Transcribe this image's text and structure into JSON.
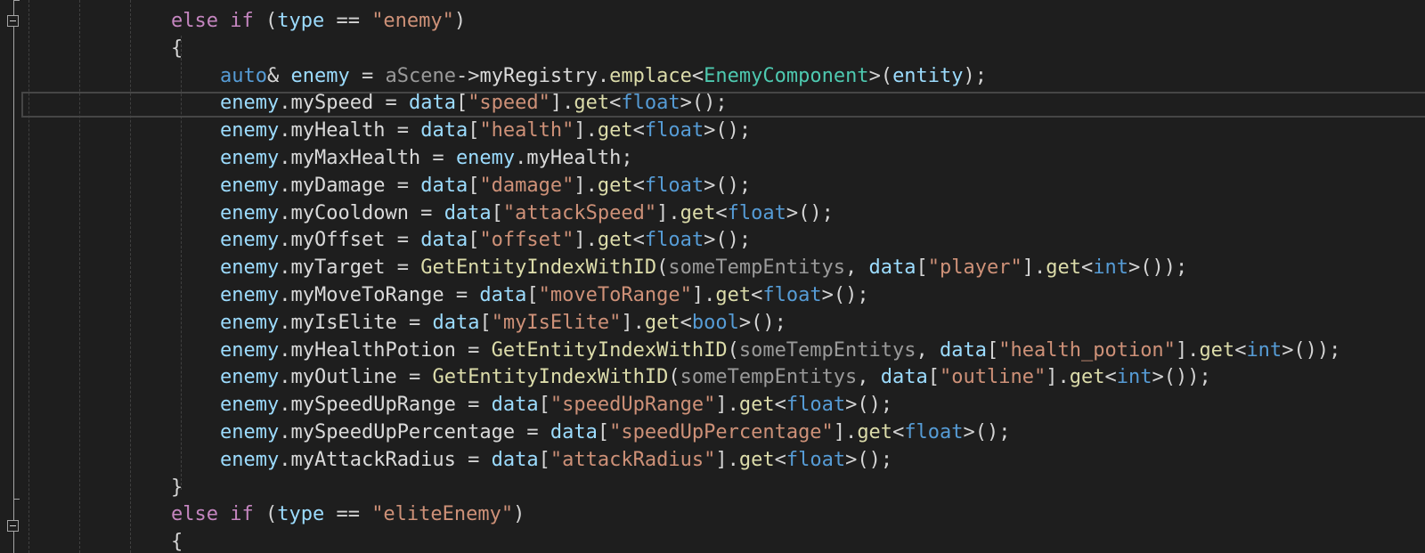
{
  "editor": {
    "lines": [
      [
        {
          "t": "else if",
          "c": "kw"
        },
        {
          "t": " (",
          "c": "punc"
        },
        {
          "t": "type",
          "c": "var"
        },
        {
          "t": " == ",
          "c": "punc"
        },
        {
          "t": "\"enemy\"",
          "c": "str"
        },
        {
          "t": ")",
          "c": "punc"
        }
      ],
      [
        {
          "t": "{",
          "c": "punc"
        }
      ],
      [
        {
          "t": "auto",
          "c": "kwb"
        },
        {
          "t": "& ",
          "c": "punc"
        },
        {
          "t": "enemy",
          "c": "var"
        },
        {
          "t": " = ",
          "c": "punc"
        },
        {
          "t": "aScene",
          "c": "gray"
        },
        {
          "t": "->",
          "c": "punc"
        },
        {
          "t": "myRegistry",
          "c": "mem"
        },
        {
          "t": ".",
          "c": "punc"
        },
        {
          "t": "emplace",
          "c": "fn"
        },
        {
          "t": "<",
          "c": "punc"
        },
        {
          "t": "EnemyComponent",
          "c": "ty"
        },
        {
          "t": ">(",
          "c": "punc"
        },
        {
          "t": "entity",
          "c": "var"
        },
        {
          "t": ");",
          "c": "punc"
        }
      ],
      [
        {
          "t": "enemy",
          "c": "var"
        },
        {
          "t": ".",
          "c": "punc"
        },
        {
          "t": "mySpeed",
          "c": "mem"
        },
        {
          "t": " = ",
          "c": "punc"
        },
        {
          "t": "data",
          "c": "var"
        },
        {
          "t": "[",
          "c": "punc"
        },
        {
          "t": "\"speed\"",
          "c": "str"
        },
        {
          "t": "].",
          "c": "punc"
        },
        {
          "t": "get",
          "c": "fn"
        },
        {
          "t": "<",
          "c": "punc"
        },
        {
          "t": "float",
          "c": "kwb"
        },
        {
          "t": ">();",
          "c": "punc"
        }
      ],
      [
        {
          "t": "enemy",
          "c": "var"
        },
        {
          "t": ".",
          "c": "punc"
        },
        {
          "t": "myHealth",
          "c": "mem"
        },
        {
          "t": " = ",
          "c": "punc"
        },
        {
          "t": "data",
          "c": "var"
        },
        {
          "t": "[",
          "c": "punc"
        },
        {
          "t": "\"health\"",
          "c": "str"
        },
        {
          "t": "].",
          "c": "punc"
        },
        {
          "t": "get",
          "c": "fn"
        },
        {
          "t": "<",
          "c": "punc"
        },
        {
          "t": "float",
          "c": "kwb"
        },
        {
          "t": ">();",
          "c": "punc"
        }
      ],
      [
        {
          "t": "enemy",
          "c": "var"
        },
        {
          "t": ".",
          "c": "punc"
        },
        {
          "t": "myMaxHealth",
          "c": "mem"
        },
        {
          "t": " = ",
          "c": "punc"
        },
        {
          "t": "enemy",
          "c": "var"
        },
        {
          "t": ".",
          "c": "punc"
        },
        {
          "t": "myHealth",
          "c": "mem"
        },
        {
          "t": ";",
          "c": "punc"
        }
      ],
      [
        {
          "t": "enemy",
          "c": "var"
        },
        {
          "t": ".",
          "c": "punc"
        },
        {
          "t": "myDamage",
          "c": "mem"
        },
        {
          "t": " = ",
          "c": "punc"
        },
        {
          "t": "data",
          "c": "var"
        },
        {
          "t": "[",
          "c": "punc"
        },
        {
          "t": "\"damage\"",
          "c": "str"
        },
        {
          "t": "].",
          "c": "punc"
        },
        {
          "t": "get",
          "c": "fn"
        },
        {
          "t": "<",
          "c": "punc"
        },
        {
          "t": "float",
          "c": "kwb"
        },
        {
          "t": ">();",
          "c": "punc"
        }
      ],
      [
        {
          "t": "enemy",
          "c": "var"
        },
        {
          "t": ".",
          "c": "punc"
        },
        {
          "t": "myCooldown",
          "c": "mem"
        },
        {
          "t": " = ",
          "c": "punc"
        },
        {
          "t": "data",
          "c": "var"
        },
        {
          "t": "[",
          "c": "punc"
        },
        {
          "t": "\"attackSpeed\"",
          "c": "str"
        },
        {
          "t": "].",
          "c": "punc"
        },
        {
          "t": "get",
          "c": "fn"
        },
        {
          "t": "<",
          "c": "punc"
        },
        {
          "t": "float",
          "c": "kwb"
        },
        {
          "t": ">();",
          "c": "punc"
        }
      ],
      [
        {
          "t": "enemy",
          "c": "var"
        },
        {
          "t": ".",
          "c": "punc"
        },
        {
          "t": "myOffset",
          "c": "mem"
        },
        {
          "t": " = ",
          "c": "punc"
        },
        {
          "t": "data",
          "c": "var"
        },
        {
          "t": "[",
          "c": "punc"
        },
        {
          "t": "\"offset\"",
          "c": "str"
        },
        {
          "t": "].",
          "c": "punc"
        },
        {
          "t": "get",
          "c": "fn"
        },
        {
          "t": "<",
          "c": "punc"
        },
        {
          "t": "float",
          "c": "kwb"
        },
        {
          "t": ">();",
          "c": "punc"
        }
      ],
      [
        {
          "t": "enemy",
          "c": "var"
        },
        {
          "t": ".",
          "c": "punc"
        },
        {
          "t": "myTarget",
          "c": "mem"
        },
        {
          "t": " = ",
          "c": "punc"
        },
        {
          "t": "GetEntityIndexWithID",
          "c": "fn"
        },
        {
          "t": "(",
          "c": "punc"
        },
        {
          "t": "someTempEntitys",
          "c": "gray"
        },
        {
          "t": ", ",
          "c": "punc"
        },
        {
          "t": "data",
          "c": "var"
        },
        {
          "t": "[",
          "c": "punc"
        },
        {
          "t": "\"player\"",
          "c": "str"
        },
        {
          "t": "].",
          "c": "punc"
        },
        {
          "t": "get",
          "c": "fn"
        },
        {
          "t": "<",
          "c": "punc"
        },
        {
          "t": "int",
          "c": "kwb"
        },
        {
          "t": ">());",
          "c": "punc"
        }
      ],
      [
        {
          "t": "enemy",
          "c": "var"
        },
        {
          "t": ".",
          "c": "punc"
        },
        {
          "t": "myMoveToRange",
          "c": "mem"
        },
        {
          "t": " = ",
          "c": "punc"
        },
        {
          "t": "data",
          "c": "var"
        },
        {
          "t": "[",
          "c": "punc"
        },
        {
          "t": "\"moveToRange\"",
          "c": "str"
        },
        {
          "t": "].",
          "c": "punc"
        },
        {
          "t": "get",
          "c": "fn"
        },
        {
          "t": "<",
          "c": "punc"
        },
        {
          "t": "float",
          "c": "kwb"
        },
        {
          "t": ">();",
          "c": "punc"
        }
      ],
      [
        {
          "t": "enemy",
          "c": "var"
        },
        {
          "t": ".",
          "c": "punc"
        },
        {
          "t": "myIsElite",
          "c": "mem"
        },
        {
          "t": " = ",
          "c": "punc"
        },
        {
          "t": "data",
          "c": "var"
        },
        {
          "t": "[",
          "c": "punc"
        },
        {
          "t": "\"myIsElite\"",
          "c": "str"
        },
        {
          "t": "].",
          "c": "punc"
        },
        {
          "t": "get",
          "c": "fn"
        },
        {
          "t": "<",
          "c": "punc"
        },
        {
          "t": "bool",
          "c": "kwb"
        },
        {
          "t": ">();",
          "c": "punc"
        }
      ],
      [
        {
          "t": "enemy",
          "c": "var"
        },
        {
          "t": ".",
          "c": "punc"
        },
        {
          "t": "myHealthPotion",
          "c": "mem"
        },
        {
          "t": " = ",
          "c": "punc"
        },
        {
          "t": "GetEntityIndexWithID",
          "c": "fn"
        },
        {
          "t": "(",
          "c": "punc"
        },
        {
          "t": "someTempEntitys",
          "c": "gray"
        },
        {
          "t": ", ",
          "c": "punc"
        },
        {
          "t": "data",
          "c": "var"
        },
        {
          "t": "[",
          "c": "punc"
        },
        {
          "t": "\"health_potion\"",
          "c": "str"
        },
        {
          "t": "].",
          "c": "punc"
        },
        {
          "t": "get",
          "c": "fn"
        },
        {
          "t": "<",
          "c": "punc"
        },
        {
          "t": "int",
          "c": "kwb"
        },
        {
          "t": ">());",
          "c": "punc"
        }
      ],
      [
        {
          "t": "enemy",
          "c": "var"
        },
        {
          "t": ".",
          "c": "punc"
        },
        {
          "t": "myOutline",
          "c": "mem"
        },
        {
          "t": " = ",
          "c": "punc"
        },
        {
          "t": "GetEntityIndexWithID",
          "c": "fn"
        },
        {
          "t": "(",
          "c": "punc"
        },
        {
          "t": "someTempEntitys",
          "c": "gray"
        },
        {
          "t": ", ",
          "c": "punc"
        },
        {
          "t": "data",
          "c": "var"
        },
        {
          "t": "[",
          "c": "punc"
        },
        {
          "t": "\"outline\"",
          "c": "str"
        },
        {
          "t": "].",
          "c": "punc"
        },
        {
          "t": "get",
          "c": "fn"
        },
        {
          "t": "<",
          "c": "punc"
        },
        {
          "t": "int",
          "c": "kwb"
        },
        {
          "t": ">());",
          "c": "punc"
        }
      ],
      [
        {
          "t": "enemy",
          "c": "var"
        },
        {
          "t": ".",
          "c": "punc"
        },
        {
          "t": "mySpeedUpRange",
          "c": "mem"
        },
        {
          "t": " = ",
          "c": "punc"
        },
        {
          "t": "data",
          "c": "var"
        },
        {
          "t": "[",
          "c": "punc"
        },
        {
          "t": "\"speedUpRange\"",
          "c": "str"
        },
        {
          "t": "].",
          "c": "punc"
        },
        {
          "t": "get",
          "c": "fn"
        },
        {
          "t": "<",
          "c": "punc"
        },
        {
          "t": "float",
          "c": "kwb"
        },
        {
          "t": ">();",
          "c": "punc"
        }
      ],
      [
        {
          "t": "enemy",
          "c": "var"
        },
        {
          "t": ".",
          "c": "punc"
        },
        {
          "t": "mySpeedUpPercentage",
          "c": "mem"
        },
        {
          "t": " = ",
          "c": "punc"
        },
        {
          "t": "data",
          "c": "var"
        },
        {
          "t": "[",
          "c": "punc"
        },
        {
          "t": "\"speedUpPercentage\"",
          "c": "str"
        },
        {
          "t": "].",
          "c": "punc"
        },
        {
          "t": "get",
          "c": "fn"
        },
        {
          "t": "<",
          "c": "punc"
        },
        {
          "t": "float",
          "c": "kwb"
        },
        {
          "t": ">();",
          "c": "punc"
        }
      ],
      [
        {
          "t": "enemy",
          "c": "var"
        },
        {
          "t": ".",
          "c": "punc"
        },
        {
          "t": "myAttackRadius",
          "c": "mem"
        },
        {
          "t": " = ",
          "c": "punc"
        },
        {
          "t": "data",
          "c": "var"
        },
        {
          "t": "[",
          "c": "punc"
        },
        {
          "t": "\"attackRadius\"",
          "c": "str"
        },
        {
          "t": "].",
          "c": "punc"
        },
        {
          "t": "get",
          "c": "fn"
        },
        {
          "t": "<",
          "c": "punc"
        },
        {
          "t": "float",
          "c": "kwb"
        },
        {
          "t": ">();",
          "c": "punc"
        }
      ],
      [
        {
          "t": "}",
          "c": "punc"
        }
      ],
      [
        {
          "t": "else if",
          "c": "kw"
        },
        {
          "t": " (",
          "c": "punc"
        },
        {
          "t": "type",
          "c": "var"
        },
        {
          "t": " == ",
          "c": "punc"
        },
        {
          "t": "\"eliteEnemy\"",
          "c": "str"
        },
        {
          "t": ")",
          "c": "punc"
        }
      ],
      [
        {
          "t": "{",
          "c": "punc"
        }
      ]
    ]
  }
}
